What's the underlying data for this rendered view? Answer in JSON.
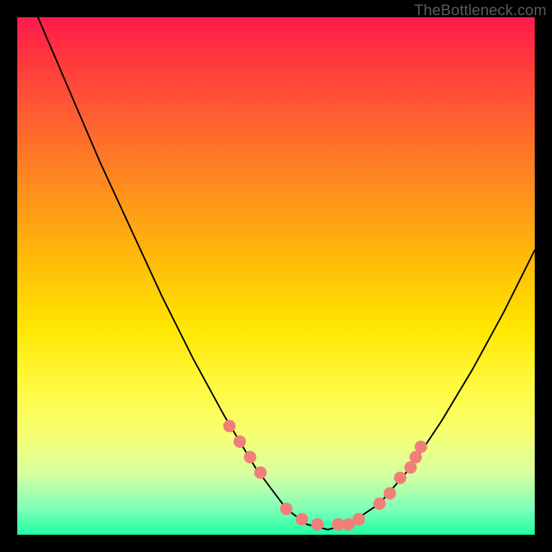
{
  "watermark": "TheBottleneck.com",
  "accent_dot_color": "#ef7f78",
  "curve_color": "#000000",
  "chart_data": {
    "type": "line",
    "title": "",
    "xlabel": "",
    "ylabel": "",
    "xlim": [
      0,
      100
    ],
    "ylim": [
      0,
      100
    ],
    "grid": false,
    "series": [
      {
        "name": "bottleneck-curve",
        "x": [
          4,
          10,
          16,
          22,
          28,
          34,
          40,
          46,
          52,
          56,
          60,
          64,
          70,
          76,
          82,
          88,
          94,
          100
        ],
        "y": [
          100,
          86,
          72,
          59,
          46,
          34,
          23,
          13,
          5,
          2,
          1,
          2,
          6,
          13,
          22,
          32,
          43,
          55
        ]
      }
    ],
    "markers": {
      "name": "highlight-dots",
      "x": [
        41,
        43,
        45,
        47,
        52,
        55,
        58,
        62,
        64,
        66,
        70,
        72,
        74,
        76,
        77,
        78
      ],
      "y": [
        21,
        18,
        15,
        12,
        5,
        3,
        2,
        2,
        2,
        3,
        6,
        8,
        11,
        13,
        15,
        17
      ]
    },
    "gradient_stops": [
      {
        "pos": 0.0,
        "color": "#ff1a4d"
      },
      {
        "pos": 0.18,
        "color": "#ff5a33"
      },
      {
        "pos": 0.46,
        "color": "#ffb80a"
      },
      {
        "pos": 0.72,
        "color": "#fffb44"
      },
      {
        "pos": 0.95,
        "color": "#7fffb8"
      },
      {
        "pos": 1.0,
        "color": "#1effa4"
      }
    ]
  }
}
